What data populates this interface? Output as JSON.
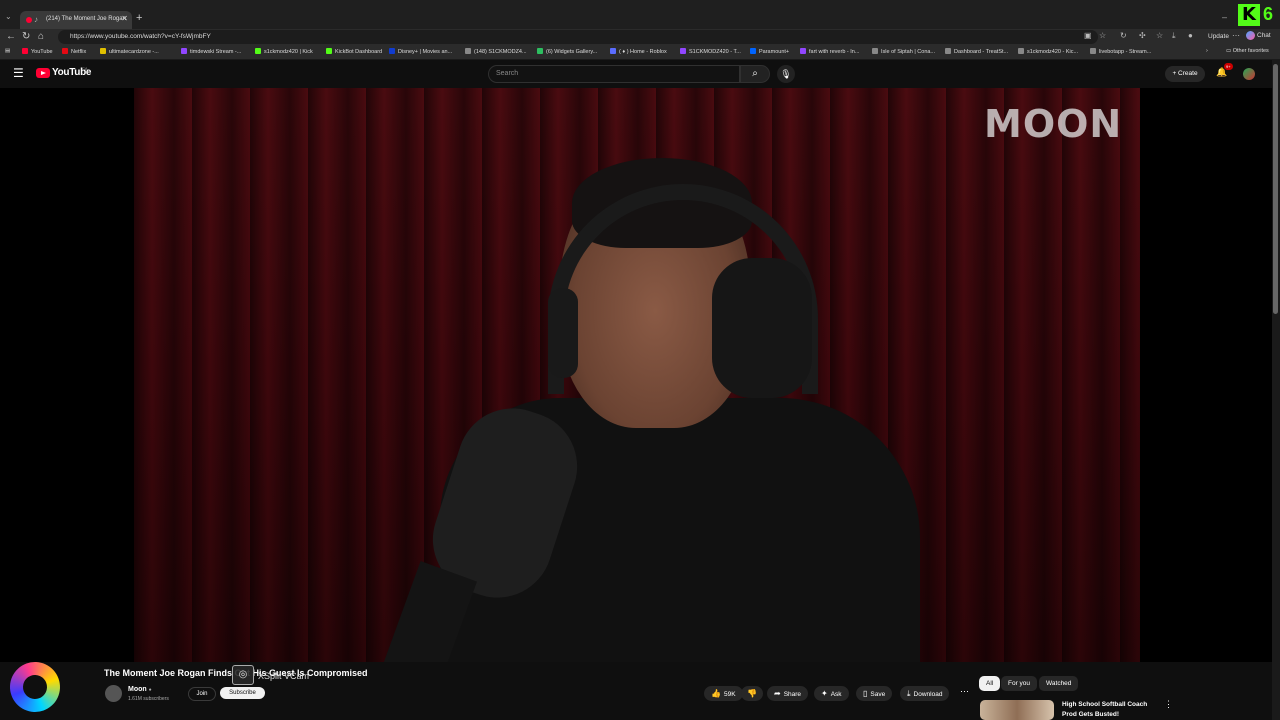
{
  "browser": {
    "tab_title": "(214) The Moment Joe Rogan",
    "url": "https://www.youtube.com/watch?v=cY-fsWjmbFY",
    "update_label": "Update",
    "chat_label": "Chat",
    "kick_badge_letter": "K",
    "kick_badge_number": "6",
    "other_favorites": "Other favorites",
    "bookmarks": [
      {
        "label": "YouTube",
        "color": "#ff0033"
      },
      {
        "label": "Netflix",
        "color": "#e50914"
      },
      {
        "label": "ultimatecardzone -...",
        "color": "#e0c000"
      },
      {
        "label": "timdewski Stream -...",
        "color": "#9146ff"
      },
      {
        "label": "s1ckmodz420 | Kick",
        "color": "#53fc18"
      },
      {
        "label": "KickBot Dashboard",
        "color": "#53fc18"
      },
      {
        "label": "Disney+ | Movies an...",
        "color": "#113ccf"
      },
      {
        "label": "(148) S1CKMODZ4...",
        "color": "#888888"
      },
      {
        "label": "(6) Widgets Gallery...",
        "color": "#2dbe60"
      },
      {
        "label": "( ♦ ) Home - Roblox",
        "color": "#5a6cff"
      },
      {
        "label": "S1CKMODZ420 - T...",
        "color": "#9146ff"
      },
      {
        "label": "Paramount+",
        "color": "#0064ff"
      },
      {
        "label": "fart with reverb - In...",
        "color": "#9146ff"
      },
      {
        "label": "Isle of Siptah | Cona...",
        "color": "#888888"
      },
      {
        "label": "Dashboard - TreatSt...",
        "color": "#888888"
      },
      {
        "label": "s1ckmodz420 - Kic...",
        "color": "#888888"
      },
      {
        "label": "livebotapp - Stream...",
        "color": "#888888"
      }
    ]
  },
  "youtube": {
    "wordmark": "YouTube",
    "region": "CA",
    "search_placeholder": "Search",
    "create_label": "Create",
    "notif_badge": "9+",
    "watermark": "MOON",
    "video_title": "The Moment Joe Rogan Finds Out His Guest Is Compromised",
    "overlay_label": "XSplit VCam",
    "channel": {
      "name": "Moon",
      "subscribers": "1.61M subscribers",
      "join_label": "Join",
      "subscribe_label": "Subscribe"
    },
    "actions": {
      "likes": "59K",
      "share": "Share",
      "ask": "Ask",
      "save": "Save",
      "download": "Download"
    },
    "chips": [
      "All",
      "For you",
      "Watched"
    ],
    "recommendation": {
      "title_line1": "High School Softball Coach",
      "title_line2": "Prod Gets Busted!"
    }
  },
  "colors": {
    "brand_red": "#ff0033",
    "kick_green": "#53fc18",
    "background": "#0f0f0f"
  }
}
